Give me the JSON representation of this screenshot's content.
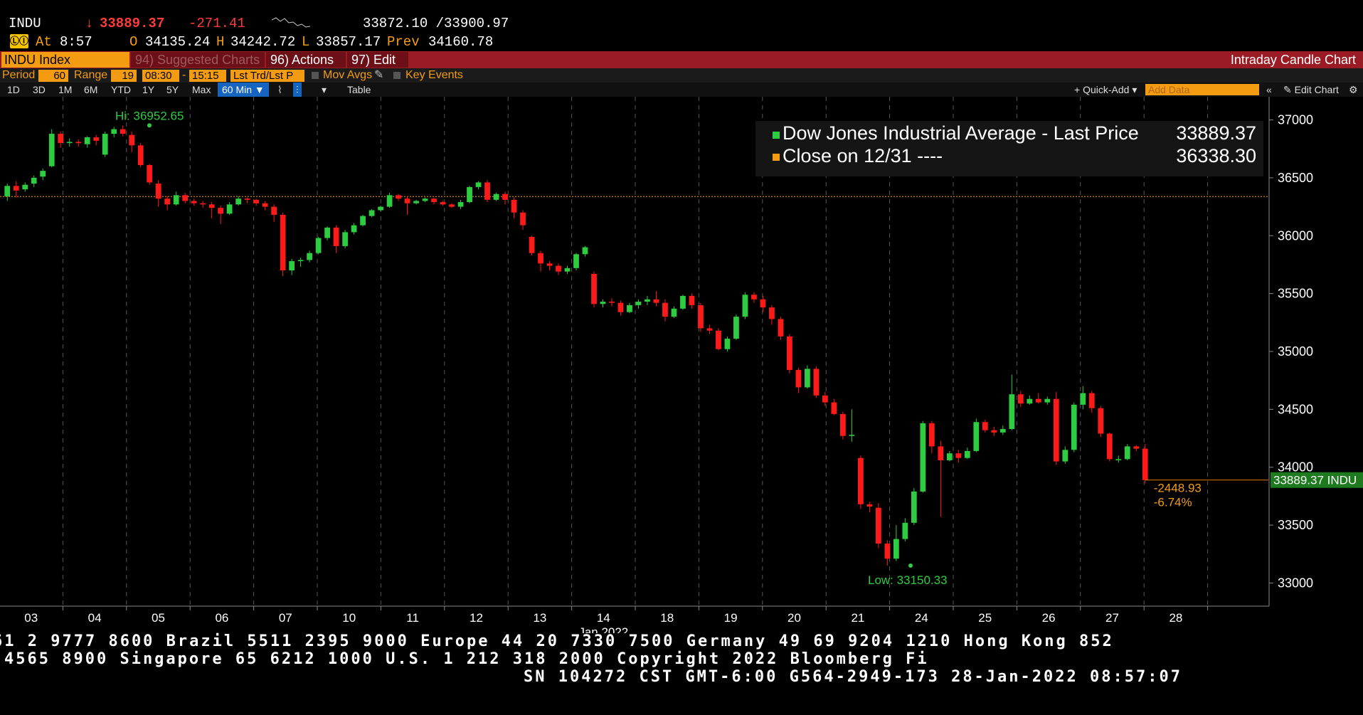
{
  "quote": {
    "ticker": "INDU",
    "arrow": "↓",
    "last": "33889.37",
    "change": "-271.41",
    "bid_ask": "33872.10 /33900.97",
    "at_label": "At",
    "time": "8:57",
    "open_label": "O",
    "open": "34135.24",
    "high_label": "H",
    "high": "34242.72",
    "low_label": "L",
    "low": "33857.17",
    "prev_label": "Prev",
    "prev": "34160.78",
    "fn_icon": "ⓁⒾ"
  },
  "func_bar": {
    "security": "INDU Index",
    "suggested": "94) Suggested Charts",
    "actions": "96) Actions ▾",
    "edit": "97) Edit ▾",
    "title": "Intraday Candle Chart"
  },
  "settings": {
    "period_label": "Period",
    "period_value": "60",
    "range_label": "Range",
    "range_value": "19",
    "start_time": "08:30",
    "dash": "-",
    "end_time": "15:15",
    "lst_trd": "Lst Trd/Lst P",
    "mov_avgs": "Mov Avgs",
    "key_events": "Key Events"
  },
  "periods": {
    "p1d": "1D",
    "p3d": "3D",
    "p1m": "1M",
    "p6m": "6M",
    "pytd": "YTD",
    "p1y": "1Y",
    "p5y": "5Y",
    "pmax": "Max",
    "interval": "60 Min ▼",
    "table": "Table",
    "quick_add": "+ Quick-Add ▾",
    "add_data_placeholder": "Add Data",
    "edit_chart": "✎ Edit Chart",
    "scroll": "«",
    "gear": "⚙"
  },
  "legend": {
    "series": "Dow Jones Industrial Average - Last Price",
    "series_value": "33889.37",
    "close_label": "Close on 12/31 ----",
    "close_value": "36338.30",
    "series_color": "#2ecc40",
    "close_color": "#f39c12"
  },
  "annotations": {
    "hi": "Hi: 36952.65",
    "low": "Low: 33150.33",
    "last_tag": "33889.37 INDU",
    "chg_abs": "-2448.93",
    "chg_pct": "-6.74%"
  },
  "chart_data": {
    "type": "candlestick",
    "x_label": "Jan 2022",
    "y_range": [
      32800,
      37200
    ],
    "y_ticks": [
      33000,
      33500,
      34000,
      34500,
      35000,
      35500,
      36000,
      36500,
      37000
    ],
    "reference_line": 36338.3,
    "last_price": 33889.37,
    "high": 36952.65,
    "low": 33150.33,
    "days": [
      "03",
      "04",
      "05",
      "06",
      "07",
      "10",
      "11",
      "12",
      "13",
      "14",
      "18",
      "19",
      "20",
      "21",
      "24",
      "25",
      "26",
      "27",
      "28"
    ],
    "candles": [
      [
        36340,
        36430,
        36300,
        36450
      ],
      [
        36430,
        36390,
        36330,
        36470
      ],
      [
        36400,
        36440,
        36380,
        36460
      ],
      [
        36450,
        36500,
        36420,
        36520
      ],
      [
        36510,
        36560,
        36480,
        36580
      ],
      [
        36600,
        36880,
        36590,
        36920
      ],
      [
        36880,
        36800,
        36760,
        36900
      ],
      [
        36800,
        36810,
        36770,
        36840
      ],
      [
        36810,
        36800,
        36770,
        36830
      ],
      [
        36790,
        36850,
        36760,
        36860
      ],
      [
        36850,
        36820,
        36780,
        36870
      ],
      [
        36700,
        36880,
        36680,
        36900
      ],
      [
        36880,
        36920,
        36850,
        36940
      ],
      [
        36920,
        36880,
        36860,
        36952
      ],
      [
        36870,
        36780,
        36720,
        36900
      ],
      [
        36780,
        36610,
        36590,
        36800
      ],
      [
        36610,
        36460,
        36440,
        36620
      ],
      [
        36450,
        36320,
        36250,
        36480
      ],
      [
        36320,
        36270,
        36220,
        36340
      ],
      [
        36270,
        36350,
        36260,
        36380
      ],
      [
        36350,
        36300,
        36280,
        36370
      ],
      [
        36300,
        36280,
        36260,
        36320
      ],
      [
        36280,
        36270,
        36240,
        36300
      ],
      [
        36270,
        36240,
        36150,
        36290
      ],
      [
        36240,
        36190,
        36100,
        36260
      ],
      [
        36190,
        36270,
        36180,
        36290
      ],
      [
        36270,
        36320,
        36260,
        36340
      ],
      [
        36320,
        36310,
        36280,
        36330
      ],
      [
        36310,
        36280,
        36260,
        36320
      ],
      [
        36280,
        36250,
        36220,
        36300
      ],
      [
        36250,
        36180,
        36120,
        36270
      ],
      [
        36180,
        35700,
        35650,
        36200
      ],
      [
        35700,
        35780,
        35660,
        35800
      ],
      [
        35780,
        35790,
        35730,
        35810
      ],
      [
        35790,
        35850,
        35770,
        35870
      ],
      [
        35850,
        35980,
        35840,
        35990
      ],
      [
        35980,
        36070,
        35960,
        36080
      ],
      [
        36070,
        35910,
        35850,
        36090
      ],
      [
        35910,
        36030,
        35890,
        36050
      ],
      [
        36030,
        36090,
        36010,
        36110
      ],
      [
        36090,
        36170,
        36080,
        36180
      ],
      [
        36170,
        36220,
        36160,
        36230
      ],
      [
        36220,
        36250,
        36210,
        36260
      ],
      [
        36250,
        36350,
        36240,
        36370
      ],
      [
        36350,
        36320,
        36300,
        36360
      ],
      [
        36320,
        36280,
        36180,
        36340
      ],
      [
        36280,
        36300,
        36270,
        36310
      ],
      [
        36300,
        36320,
        36290,
        36330
      ],
      [
        36320,
        36290,
        36270,
        36330
      ],
      [
        36290,
        36270,
        36260,
        36300
      ],
      [
        36270,
        36250,
        36240,
        36280
      ],
      [
        36250,
        36290,
        36230,
        36310
      ],
      [
        36290,
        36420,
        36280,
        36430
      ],
      [
        36420,
        36460,
        36400,
        36470
      ],
      [
        36460,
        36310,
        36290,
        36480
      ],
      [
        36310,
        36360,
        36300,
        36370
      ],
      [
        36360,
        36310,
        36270,
        36380
      ],
      [
        36310,
        36200,
        36150,
        36330
      ],
      [
        36200,
        36090,
        36050,
        36220
      ],
      [
        35990,
        35850,
        35830,
        36000
      ],
      [
        35850,
        35760,
        35690,
        35870
      ],
      [
        35760,
        35740,
        35700,
        35780
      ],
      [
        35740,
        35690,
        35660,
        35760
      ],
      [
        35690,
        35720,
        35670,
        35740
      ],
      [
        35720,
        35840,
        35700,
        35850
      ],
      [
        35840,
        35900,
        35820,
        35910
      ],
      [
        35670,
        35410,
        35380,
        35690
      ],
      [
        35410,
        35430,
        35380,
        35450
      ],
      [
        35430,
        35420,
        35390,
        35460
      ],
      [
        35420,
        35340,
        35310,
        35440
      ],
      [
        35340,
        35400,
        35330,
        35420
      ],
      [
        35400,
        35430,
        35370,
        35450
      ],
      [
        35430,
        35450,
        35400,
        35480
      ],
      [
        35450,
        35420,
        35390,
        35520
      ],
      [
        35420,
        35300,
        35260,
        35450
      ],
      [
        35300,
        35370,
        35290,
        35390
      ],
      [
        35370,
        35480,
        35360,
        35490
      ],
      [
        35480,
        35400,
        35370,
        35500
      ],
      [
        35400,
        35200,
        35170,
        35420
      ],
      [
        35200,
        35180,
        35150,
        35230
      ],
      [
        35180,
        35020,
        35010,
        35200
      ],
      [
        35020,
        35110,
        35000,
        35130
      ],
      [
        35110,
        35300,
        35100,
        35320
      ],
      [
        35300,
        35490,
        35280,
        35510
      ],
      [
        35490,
        35450,
        35420,
        35510
      ],
      [
        35450,
        35380,
        35340,
        35480
      ],
      [
        35380,
        35280,
        35230,
        35400
      ],
      [
        35280,
        35130,
        35100,
        35300
      ],
      [
        35130,
        34840,
        34810,
        35150
      ],
      [
        34840,
        34690,
        34640,
        34860
      ],
      [
        34690,
        34850,
        34680,
        34880
      ],
      [
        34850,
        34620,
        34600,
        34870
      ],
      [
        34620,
        34560,
        34530,
        34650
      ],
      [
        34560,
        34460,
        34450,
        34590
      ],
      [
        34460,
        34270,
        34240,
        34480
      ],
      [
        34270,
        34280,
        34220,
        34500
      ],
      [
        34080,
        33680,
        33640,
        34100
      ],
      [
        33680,
        33660,
        33610,
        33700
      ],
      [
        33650,
        33340,
        33300,
        33690
      ],
      [
        33340,
        33210,
        33150,
        33370
      ],
      [
        33210,
        33380,
        33190,
        33500
      ],
      [
        33380,
        33520,
        33360,
        33560
      ],
      [
        33520,
        33790,
        33500,
        33820
      ],
      [
        33790,
        34380,
        33780,
        34400
      ],
      [
        34380,
        34180,
        34120,
        34400
      ],
      [
        34180,
        34060,
        33570,
        34230
      ],
      [
        34060,
        34120,
        34050,
        34140
      ],
      [
        34120,
        34080,
        34040,
        34150
      ],
      [
        34080,
        34140,
        34070,
        34170
      ],
      [
        34140,
        34390,
        34130,
        34420
      ],
      [
        34390,
        34320,
        34300,
        34410
      ],
      [
        34320,
        34300,
        34270,
        34350
      ],
      [
        34300,
        34330,
        34280,
        34360
      ],
      [
        34330,
        34630,
        34320,
        34800
      ],
      [
        34630,
        34550,
        34520,
        34660
      ],
      [
        34550,
        34590,
        34540,
        34620
      ],
      [
        34590,
        34560,
        34550,
        34640
      ],
      [
        34560,
        34590,
        34540,
        34610
      ],
      [
        34590,
        34050,
        34020,
        34650
      ],
      [
        34050,
        34150,
        34030,
        34180
      ],
      [
        34150,
        34540,
        34130,
        34560
      ],
      [
        34540,
        34640,
        34500,
        34700
      ],
      [
        34640,
        34510,
        34470,
        34660
      ],
      [
        34510,
        34290,
        34260,
        34530
      ],
      [
        34290,
        34070,
        34050,
        34300
      ],
      [
        34070,
        34070,
        34040,
        34100
      ],
      [
        34070,
        34180,
        34060,
        34200
      ],
      [
        34180,
        34160,
        34140,
        34190
      ],
      [
        34160,
        33889,
        33860,
        34200
      ]
    ]
  }
}
